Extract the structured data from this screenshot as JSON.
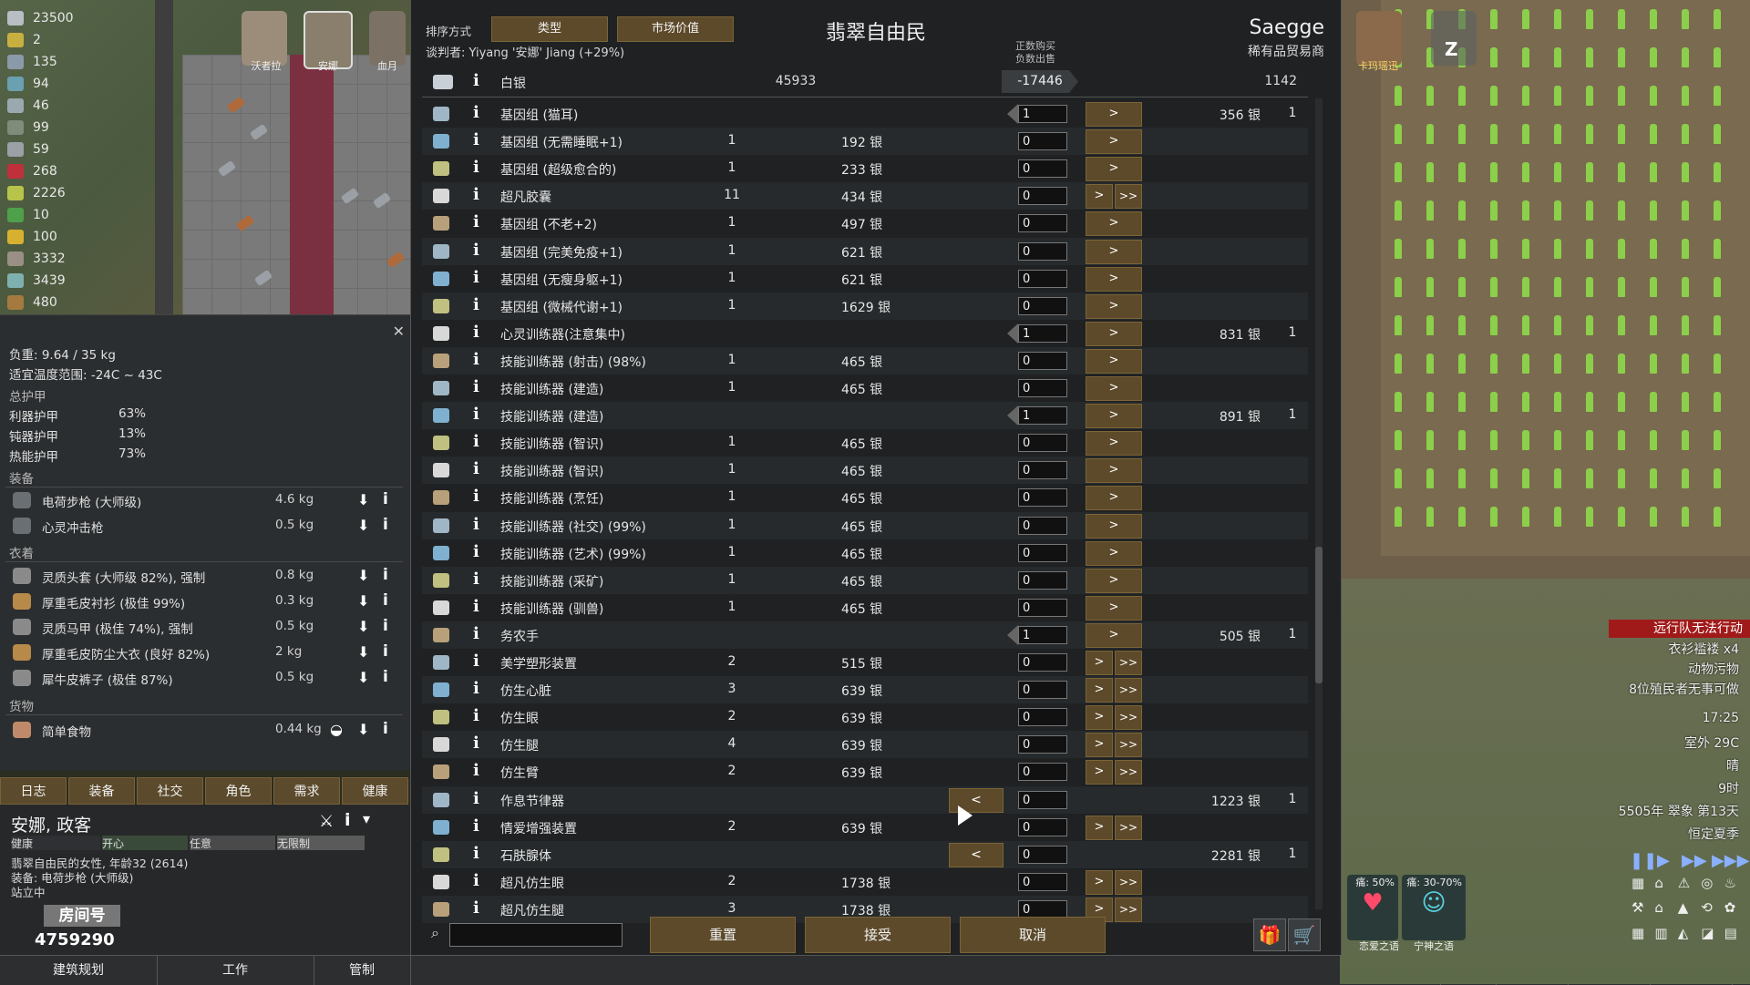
{
  "resources": [
    {
      "value": "23500",
      "icon": "silver-icon",
      "color": "#b8bec4"
    },
    {
      "value": "2",
      "icon": "gold-icon",
      "color": "#c8b040"
    },
    {
      "value": "135",
      "icon": "component-icon",
      "color": "#8a9aa8"
    },
    {
      "value": "94",
      "icon": "medicine-icon",
      "color": "#6aa0b0"
    },
    {
      "value": "46",
      "icon": "plasteel-icon",
      "color": "#9aa8b0"
    },
    {
      "value": "99",
      "icon": "uranium-icon",
      "color": "#7f8c7a"
    },
    {
      "value": "59",
      "icon": "steel-icon",
      "color": "#9aa0a6"
    },
    {
      "value": "268",
      "icon": "meat-icon",
      "color": "#c0303a"
    },
    {
      "value": "2226",
      "icon": "rice-icon",
      "color": "#b7c44a"
    },
    {
      "value": "10",
      "icon": "herb-icon",
      "color": "#4ea04a"
    },
    {
      "value": "100",
      "icon": "corn-icon",
      "color": "#d8b030"
    },
    {
      "value": "3332",
      "icon": "stone-icon",
      "color": "#9a8f84"
    },
    {
      "value": "3439",
      "icon": "cloth-icon",
      "color": "#7fb0b0"
    },
    {
      "value": "480",
      "icon": "wood-icon",
      "color": "#a57a3e"
    }
  ],
  "top_pawns": [
    "沃者拉",
    "安娜",
    "血月"
  ],
  "inspector": {
    "load": "负重: 9.64 / 35 kg",
    "comfort": "适宜温度范围: -24C ~ 43C",
    "armor_header": "总护甲",
    "armor": [
      {
        "label": "利器护甲",
        "value": "63%"
      },
      {
        "label": "钝器护甲",
        "value": "13%"
      },
      {
        "label": "热能护甲",
        "value": "73%"
      }
    ],
    "equipment_header": "装备",
    "equipment": [
      {
        "name": "电荷步枪 (大师级)",
        "weight": "4.6 kg"
      },
      {
        "name": "心灵冲击枪",
        "weight": "0.5 kg"
      }
    ],
    "apparel_header": "衣着",
    "apparel": [
      {
        "name": "灵质头套 (大师级 82%), 强制",
        "weight": "0.8 kg"
      },
      {
        "name": "厚重毛皮衬衫 (极佳 99%)",
        "weight": "0.3 kg"
      },
      {
        "name": "灵质马甲 (极佳 74%), 强制",
        "weight": "0.5 kg"
      },
      {
        "name": "厚重毛皮防尘大衣 (良好 82%)",
        "weight": "2 kg"
      },
      {
        "name": "犀牛皮裤子 (极佳 87%)",
        "weight": "0.5 kg"
      }
    ],
    "inventory_header": "货物",
    "inventory": [
      {
        "name": "简单食物",
        "weight": "0.44 kg"
      }
    ]
  },
  "tabs": [
    "日志",
    "装备",
    "社交",
    "角色",
    "需求",
    "健康"
  ],
  "colonist": {
    "name": "安娜, 政客",
    "status": [
      "健康",
      "开心",
      "任意",
      "无限制"
    ],
    "desc1": "翡翠自由民的女性, 年龄32 (2614)",
    "desc2": "装备: 电荷步枪 (大师级)",
    "desc3": "站立中",
    "watermark_label": "房间号",
    "watermark_number": "4759290"
  },
  "bottom_bar": [
    "建筑规划",
    "工作",
    "管制"
  ],
  "trade": {
    "sort_label": "排序方式",
    "sort_buttons": [
      "类型",
      "市场价值"
    ],
    "title": "翡翠自由民",
    "negotiator": "谈判者: Yiyang '安娜' Jiang (+29%)",
    "trader_name": "Saegge",
    "trader_kind": "稀有品贸易商",
    "col_hint_1": "正数购买",
    "col_hint_2": "负数出售",
    "silver": {
      "name": "白银",
      "colony": "45933",
      "amount": "-17446",
      "trader": "1142"
    },
    "reset": "重置",
    "accept": "接受",
    "cancel": "取消",
    "rows": [
      {
        "name": "基因组 (猫耳)",
        "count": "",
        "price": "",
        "input": "1",
        "t_price": "356 银",
        "t_count": "1",
        "buttons": "single",
        "left": true
      },
      {
        "name": "基因组 (无需睡眠+1)",
        "count": "1",
        "price": "192 银",
        "input": "0",
        "t_price": "",
        "t_count": "",
        "buttons": "single"
      },
      {
        "name": "基因组 (超级愈合的)",
        "count": "1",
        "price": "233 银",
        "input": "0",
        "t_price": "",
        "t_count": "",
        "buttons": "single"
      },
      {
        "name": "超凡胶囊",
        "count": "11",
        "price": "434 银",
        "input": "0",
        "t_price": "",
        "t_count": "",
        "buttons": "double"
      },
      {
        "name": "基因组 (不老+2)",
        "count": "1",
        "price": "497 银",
        "input": "0",
        "t_price": "",
        "t_count": "",
        "buttons": "single"
      },
      {
        "name": "基因组 (完美免疫+1)",
        "count": "1",
        "price": "621 银",
        "input": "0",
        "t_price": "",
        "t_count": "",
        "buttons": "single"
      },
      {
        "name": "基因组 (无瘦身躯+1)",
        "count": "1",
        "price": "621 银",
        "input": "0",
        "t_price": "",
        "t_count": "",
        "buttons": "single"
      },
      {
        "name": "基因组 (微械代谢+1)",
        "count": "1",
        "price": "1629 银",
        "input": "0",
        "t_price": "",
        "t_count": "",
        "buttons": "single"
      },
      {
        "name": "心灵训练器(注意集中)",
        "count": "",
        "price": "",
        "input": "1",
        "t_price": "831 银",
        "t_count": "1",
        "buttons": "single",
        "left": true
      },
      {
        "name": "技能训练器 (射击) (98%)",
        "count": "1",
        "price": "465 银",
        "input": "0",
        "t_price": "",
        "t_count": "",
        "buttons": "single"
      },
      {
        "name": "技能训练器 (建造)",
        "count": "1",
        "price": "465 银",
        "input": "0",
        "t_price": "",
        "t_count": "",
        "buttons": "single"
      },
      {
        "name": "技能训练器 (建造)",
        "count": "",
        "price": "",
        "input": "1",
        "t_price": "891 银",
        "t_count": "1",
        "buttons": "single",
        "left": true
      },
      {
        "name": "技能训练器 (智识)",
        "count": "1",
        "price": "465 银",
        "input": "0",
        "t_price": "",
        "t_count": "",
        "buttons": "single"
      },
      {
        "name": "技能训练器 (智识)",
        "count": "1",
        "price": "465 银",
        "input": "0",
        "t_price": "",
        "t_count": "",
        "buttons": "single"
      },
      {
        "name": "技能训练器 (烹饪)",
        "count": "1",
        "price": "465 银",
        "input": "0",
        "t_price": "",
        "t_count": "",
        "buttons": "single"
      },
      {
        "name": "技能训练器 (社交) (99%)",
        "count": "1",
        "price": "465 银",
        "input": "0",
        "t_price": "",
        "t_count": "",
        "buttons": "single"
      },
      {
        "name": "技能训练器 (艺术) (99%)",
        "count": "1",
        "price": "465 银",
        "input": "0",
        "t_price": "",
        "t_count": "",
        "buttons": "single"
      },
      {
        "name": "技能训练器 (采矿)",
        "count": "1",
        "price": "465 银",
        "input": "0",
        "t_price": "",
        "t_count": "",
        "buttons": "single"
      },
      {
        "name": "技能训练器 (驯兽)",
        "count": "1",
        "price": "465 银",
        "input": "0",
        "t_price": "",
        "t_count": "",
        "buttons": "single"
      },
      {
        "name": "务农手",
        "count": "",
        "price": "",
        "input": "1",
        "t_price": "505 银",
        "t_count": "1",
        "buttons": "single",
        "left": true
      },
      {
        "name": "美学塑形装置",
        "count": "2",
        "price": "515 银",
        "input": "0",
        "t_price": "",
        "t_count": "",
        "buttons": "double"
      },
      {
        "name": "仿生心脏",
        "count": "3",
        "price": "639 银",
        "input": "0",
        "t_price": "",
        "t_count": "",
        "buttons": "double"
      },
      {
        "name": "仿生眼",
        "count": "2",
        "price": "639 银",
        "input": "0",
        "t_price": "",
        "t_count": "",
        "buttons": "double"
      },
      {
        "name": "仿生腿",
        "count": "4",
        "price": "639 银",
        "input": "0",
        "t_price": "",
        "t_count": "",
        "buttons": "double"
      },
      {
        "name": "仿生臂",
        "count": "2",
        "price": "639 银",
        "input": "0",
        "t_price": "",
        "t_count": "",
        "buttons": "double"
      },
      {
        "name": "作息节律器",
        "count": "",
        "price": "",
        "input": "0",
        "t_price": "1223 银",
        "t_count": "1",
        "buttons": "lt"
      },
      {
        "name": "情爱增强装置",
        "count": "2",
        "price": "639 银",
        "input": "0",
        "t_price": "",
        "t_count": "",
        "buttons": "double"
      },
      {
        "name": "石肤腺体",
        "count": "",
        "price": "",
        "input": "0",
        "t_price": "2281 银",
        "t_count": "1",
        "buttons": "lt"
      },
      {
        "name": "超凡仿生眼",
        "count": "2",
        "price": "1738 银",
        "input": "0",
        "t_price": "",
        "t_count": "",
        "buttons": "double"
      },
      {
        "name": "超凡仿生腿",
        "count": "3",
        "price": "1738 银",
        "input": "0",
        "t_price": "",
        "t_count": "",
        "buttons": "double"
      }
    ]
  },
  "right_hud": {
    "alert": "远行队无法行动",
    "notes": [
      "衣衫褴褛 x4",
      "动物污物",
      "8位殖民者无事可做"
    ],
    "time": "17:25",
    "temp": "室外 29C",
    "weather": "晴",
    "hour": "9时",
    "date": "5505年 翠象 第13天",
    "season": "恒定夏季",
    "pawns": [
      "卡玛瑶迅"
    ],
    "sleep_mark": "Z",
    "psy_labels": [
      "痛: 50%",
      "痛: 30-70%"
    ],
    "psy_names": [
      "恋爱之语",
      "宁神之语"
    ]
  }
}
